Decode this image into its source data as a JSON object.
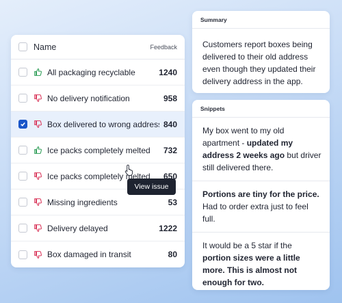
{
  "table": {
    "header": {
      "name": "Name",
      "feedback": "Feedback"
    },
    "rows": [
      {
        "label": "All packaging recyclable",
        "count": "1240",
        "sentiment": "thumbs-up-icon",
        "checked": false
      },
      {
        "label": "No delivery notification",
        "count": "958",
        "sentiment": "thumbs-down-icon",
        "checked": false
      },
      {
        "label": "Box delivered to wrong address",
        "count": "840",
        "sentiment": "thumbs-down-icon",
        "checked": true
      },
      {
        "label": "Ice packs completely melted",
        "count": "732",
        "sentiment": "thumbs-up-icon",
        "checked": false
      },
      {
        "label": "Ice packs completely melted",
        "count": "650",
        "sentiment": "thumbs-down-icon",
        "checked": false
      },
      {
        "label": "Missing ingredients",
        "count": "53",
        "sentiment": "thumbs-down-icon",
        "checked": false
      },
      {
        "label": "Delivery delayed",
        "count": "1222",
        "sentiment": "thumbs-down-icon",
        "checked": false
      },
      {
        "label": "Box damaged in transit",
        "count": "80",
        "sentiment": "thumbs-down-icon",
        "checked": false
      }
    ],
    "tooltip": "View issue"
  },
  "summary": {
    "title": "Summary",
    "text": "Customers report boxes being delivered to their old address even though they updated their delivery address in the app."
  },
  "snippets": {
    "title": "Snippets",
    "items": [
      {
        "parts": [
          {
            "text": "My box went to my old apartment - ",
            "bold": false
          },
          {
            "text": "updated my address 2 weeks ago",
            "bold": true
          },
          {
            "text": " but driver still delivered there.",
            "bold": false
          }
        ]
      },
      {
        "parts": [
          {
            "text": "Portions are tiny for the price.",
            "bold": true
          },
          {
            "text": " Had to order extra just to feel full.",
            "bold": false
          }
        ]
      },
      {
        "parts": [
          {
            "text": "It would be a 5 star if the ",
            "bold": false
          },
          {
            "text": "portion sizes were a little more. This is almost not enough for two.",
            "bold": true
          }
        ]
      }
    ]
  },
  "colors": {
    "thumbs_up": "#2f9e58",
    "thumbs_down": "#d9365a",
    "accent": "#1a56c9",
    "tooltip_bg": "#1e2330"
  }
}
